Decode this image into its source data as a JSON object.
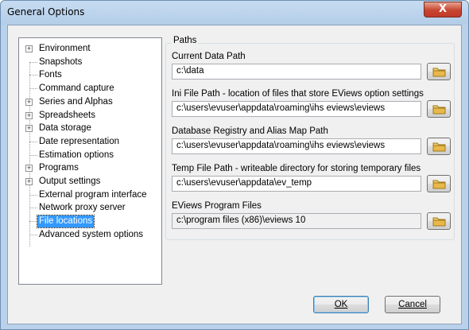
{
  "window": {
    "title": "General Options",
    "close_glyph": "X"
  },
  "tree": {
    "items": [
      {
        "label": "Environment",
        "expandable": true
      },
      {
        "label": "Snapshots",
        "expandable": false
      },
      {
        "label": "Fonts",
        "expandable": false
      },
      {
        "label": "Command capture",
        "expandable": false
      },
      {
        "label": "Series and Alphas",
        "expandable": true
      },
      {
        "label": "Spreadsheets",
        "expandable": true
      },
      {
        "label": "Data storage",
        "expandable": true
      },
      {
        "label": "Date representation",
        "expandable": false
      },
      {
        "label": "Estimation options",
        "expandable": false
      },
      {
        "label": "Programs",
        "expandable": true
      },
      {
        "label": "Output settings",
        "expandable": true
      },
      {
        "label": "External program interface",
        "expandable": false
      },
      {
        "label": "Network proxy server",
        "expandable": false
      },
      {
        "label": "File locations",
        "expandable": false,
        "selected": true
      },
      {
        "label": "Advanced system options",
        "expandable": false
      }
    ],
    "expander_glyph": "+"
  },
  "paths": {
    "group_title": "Paths",
    "fields": [
      {
        "label": "Current Data Path",
        "value": "c:\\data",
        "readonly": false
      },
      {
        "label": "Ini File Path - location of files that store EViews option settings",
        "value": "c:\\users\\evuser\\appdata\\roaming\\ihs eviews\\eviews",
        "readonly": false
      },
      {
        "label": "Database Registry and Alias Map Path",
        "value": "c:\\users\\evuser\\appdata\\roaming\\ihs eviews\\eviews",
        "readonly": false
      },
      {
        "label": "Temp File Path  -  writeable directory for storing temporary files",
        "value": "c:\\users\\evuser\\appdata\\ev_temp",
        "readonly": false
      },
      {
        "label": "EViews Program Files",
        "value": "c:\\program files (x86)\\eviews 10",
        "readonly": true
      }
    ],
    "browse_icon": "folder-icon"
  },
  "buttons": {
    "ok": "OK",
    "cancel": "Cancel"
  },
  "colors": {
    "selection": "#3399ff",
    "title_bar": "#b9d1ea",
    "close_button": "#c7462f",
    "folder": "#e8b84a"
  }
}
